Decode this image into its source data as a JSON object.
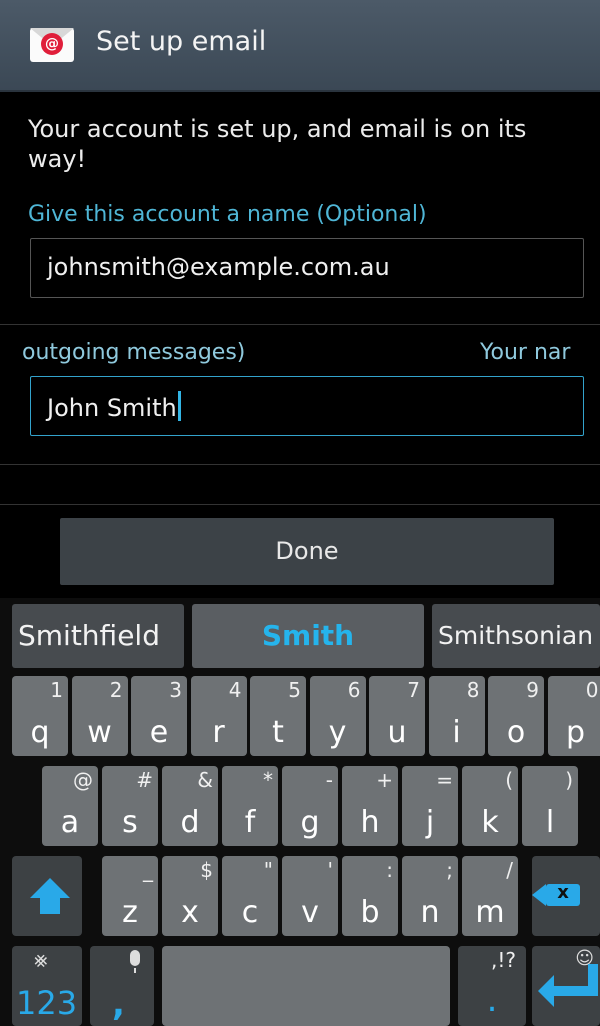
{
  "titlebar": {
    "title": "Set up email",
    "icon": "email-app-icon"
  },
  "content": {
    "message": "Your account is set up, and email is on its way!",
    "account_name_label": "Give this account a name (Optional)",
    "account_name_value": "johnsmith@example.com.au",
    "your_name_label_left": "outgoing messages)",
    "your_name_label_right": "Your nar",
    "your_name_value": "John Smith"
  },
  "done_label": "Done",
  "keyboard": {
    "suggestions": [
      "Smithfield",
      "Smith",
      "Smithsonian"
    ],
    "row1": [
      {
        "k": "q",
        "s": "1"
      },
      {
        "k": "w",
        "s": "2"
      },
      {
        "k": "e",
        "s": "3"
      },
      {
        "k": "r",
        "s": "4"
      },
      {
        "k": "t",
        "s": "5"
      },
      {
        "k": "y",
        "s": "6"
      },
      {
        "k": "u",
        "s": "7"
      },
      {
        "k": "i",
        "s": "8"
      },
      {
        "k": "o",
        "s": "9"
      },
      {
        "k": "p",
        "s": "0"
      }
    ],
    "row2": [
      {
        "k": "a",
        "s": "@"
      },
      {
        "k": "s",
        "s": "#"
      },
      {
        "k": "d",
        "s": "&"
      },
      {
        "k": "f",
        "s": "*"
      },
      {
        "k": "g",
        "s": "-"
      },
      {
        "k": "h",
        "s": "+"
      },
      {
        "k": "j",
        "s": "="
      },
      {
        "k": "k",
        "s": "("
      },
      {
        "k": "l",
        "s": ")"
      }
    ],
    "row3": [
      {
        "k": "z",
        "s": "_"
      },
      {
        "k": "x",
        "s": "$"
      },
      {
        "k": "c",
        "s": "\""
      },
      {
        "k": "v",
        "s": "'"
      },
      {
        "k": "b",
        "s": ":"
      },
      {
        "k": "n",
        "s": ";"
      },
      {
        "k": "m",
        "s": "/"
      }
    ],
    "num_label": "123",
    "comma_label": ",",
    "dot_label": ".",
    "dot_sub": ",!?",
    "backspace_x": "x"
  }
}
